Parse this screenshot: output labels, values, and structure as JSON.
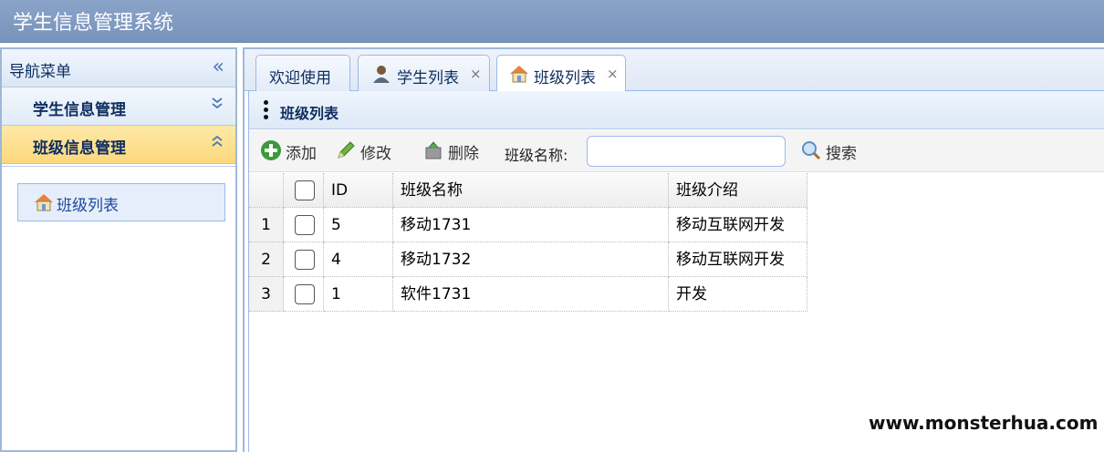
{
  "app": {
    "title": "学生信息管理系统"
  },
  "nav": {
    "title": "导航菜单",
    "collapse_icon": "double-chevron-left-icon",
    "sections": [
      {
        "label": "学生信息管理",
        "icon": "double-chevron-down-icon",
        "expanded": false
      },
      {
        "label": "班级信息管理",
        "icon": "double-chevron-up-icon",
        "expanded": true
      }
    ],
    "items": [
      {
        "label": "班级列表",
        "icon": "house-icon"
      }
    ]
  },
  "tabs": [
    {
      "label": "欢迎使用",
      "closable": false
    },
    {
      "label": "学生列表",
      "icon": "user-icon",
      "closable": true,
      "close": "×"
    },
    {
      "label": "班级列表",
      "icon": "house-icon",
      "closable": true,
      "close": "×",
      "active": true
    }
  ],
  "panel": {
    "title": "班级列表",
    "icon": "vertical-dots-icon"
  },
  "toolbar": {
    "add_label": "添加",
    "edit_label": "修改",
    "delete_label": "删除",
    "search_field_label": "班级名称:",
    "search_value": "",
    "search_label": "搜索"
  },
  "grid": {
    "columns": [
      "ID",
      "班级名称",
      "班级介绍"
    ],
    "rows": [
      {
        "num": "1",
        "id": "5",
        "name": "移动1731",
        "intro": "移动互联网开发"
      },
      {
        "num": "2",
        "id": "4",
        "name": "移动1732",
        "intro": "移动互联网开发"
      },
      {
        "num": "3",
        "id": "1",
        "name": "软件1731",
        "intro": "开发"
      }
    ]
  },
  "watermark": "www.monsterhua.com"
}
